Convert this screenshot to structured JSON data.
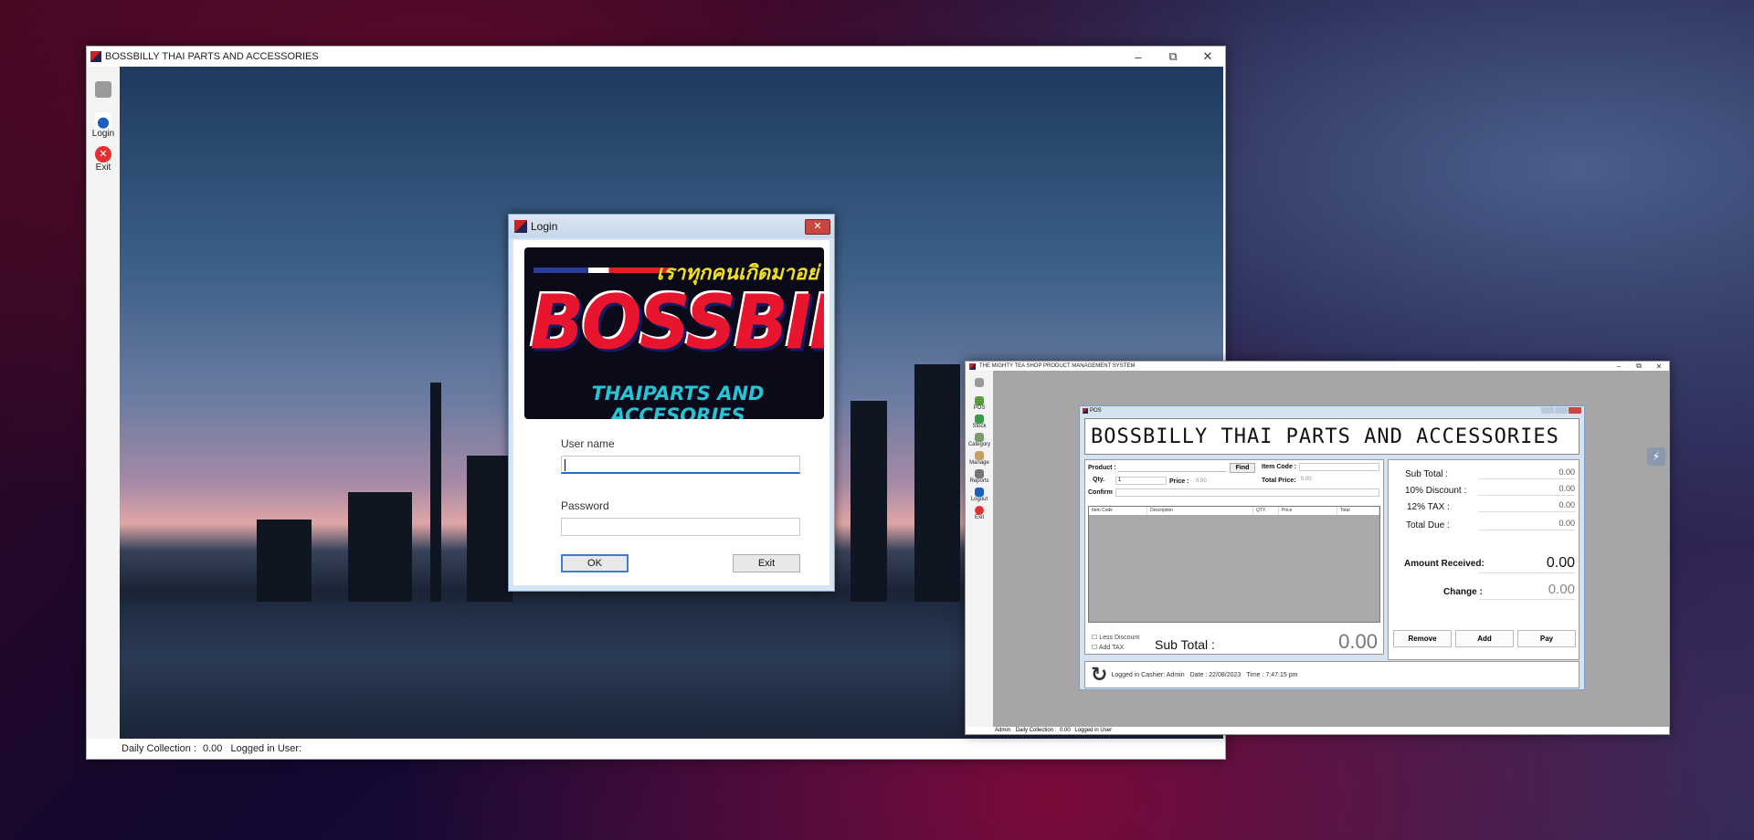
{
  "main_window": {
    "title": "BOSSBILLY THAI PARTS AND ACCESSORIES",
    "controls": {
      "minimize": "–",
      "maximize": "⧉",
      "close": "✕"
    },
    "sidebar": {
      "items": [
        {
          "label": ""
        },
        {
          "label": "Login"
        },
        {
          "label": "Exit"
        }
      ]
    },
    "statusbar": {
      "daily_collection_label": "Daily Collection :",
      "daily_collection_value": "0.00",
      "logged_in_label": "Logged in User:"
    }
  },
  "login_dialog": {
    "title": "Login",
    "close": "✕",
    "logo": {
      "thai_text": "เราทุกคนเกิดมาอย่",
      "brand": "BOSSBILLY",
      "tagline": "THAIPARTS AND ACCESORIES"
    },
    "username_label": "User name",
    "username_value": "",
    "password_label": "Password",
    "password_value": "",
    "ok_label": "OK",
    "exit_label": "Exit"
  },
  "pos_window": {
    "title": "THE MIGHTY TEA SHOP PRODUCT MANAGEMENT SYSTEM",
    "controls": {
      "minimize": "–",
      "maximize": "⧉",
      "close": "✕"
    },
    "sidebar": {
      "items": [
        {
          "label": ""
        },
        {
          "label": "POS"
        },
        {
          "label": "Stock"
        },
        {
          "label": "Category"
        },
        {
          "label": "Manage"
        },
        {
          "label": "Reports"
        },
        {
          "label": "Logout"
        },
        {
          "label": "Exit"
        }
      ]
    },
    "statusbar": {
      "user": "Admin",
      "daily_collection_label": "Daily Collection :",
      "daily_collection_value": "0.00",
      "logged_in_label": "Logged in User"
    }
  },
  "pos_dialog": {
    "title": "POS",
    "banner": "BOSSBILLY THAI PARTS AND ACCESSORIES",
    "product_label": "Product :",
    "product_value": "",
    "find_label": "Find",
    "item_code_label": "Item Code :",
    "qty_label": "Qty.",
    "qty_value": "1",
    "price_label": "Price :",
    "price_value": "0.00",
    "total_price_label": "Total Price:",
    "total_price_value": "0.00",
    "confirm_label": "Confirm",
    "columns": [
      "Item Code",
      "Description",
      "QTY.",
      "Price",
      "Total"
    ],
    "less_discount_label": "Less Discount",
    "add_tax_label": "Add TAX",
    "subtotal_label": "Sub Total :",
    "subtotal_value": "0.00",
    "summary": {
      "sub_total_label": "Sub Total :",
      "sub_total_value": "0.00",
      "discount_label": "10% Discount :",
      "discount_value": "0.00",
      "tax_label": "12% TAX :",
      "tax_value": "0.00",
      "total_due_label": "Total Due :",
      "total_due_value": "0.00",
      "amount_received_label": "Amount Received:",
      "amount_received_value": "0.00",
      "change_label": "Change :",
      "change_value": "0.00"
    },
    "remove_label": "Remove",
    "add_label": "Add",
    "pay_label": "Pay",
    "footer": {
      "logged_in": "Logged in Cashier: Admin",
      "date": "Date :  22/08/2023",
      "time": "Time :  7:47:15 pm"
    }
  }
}
